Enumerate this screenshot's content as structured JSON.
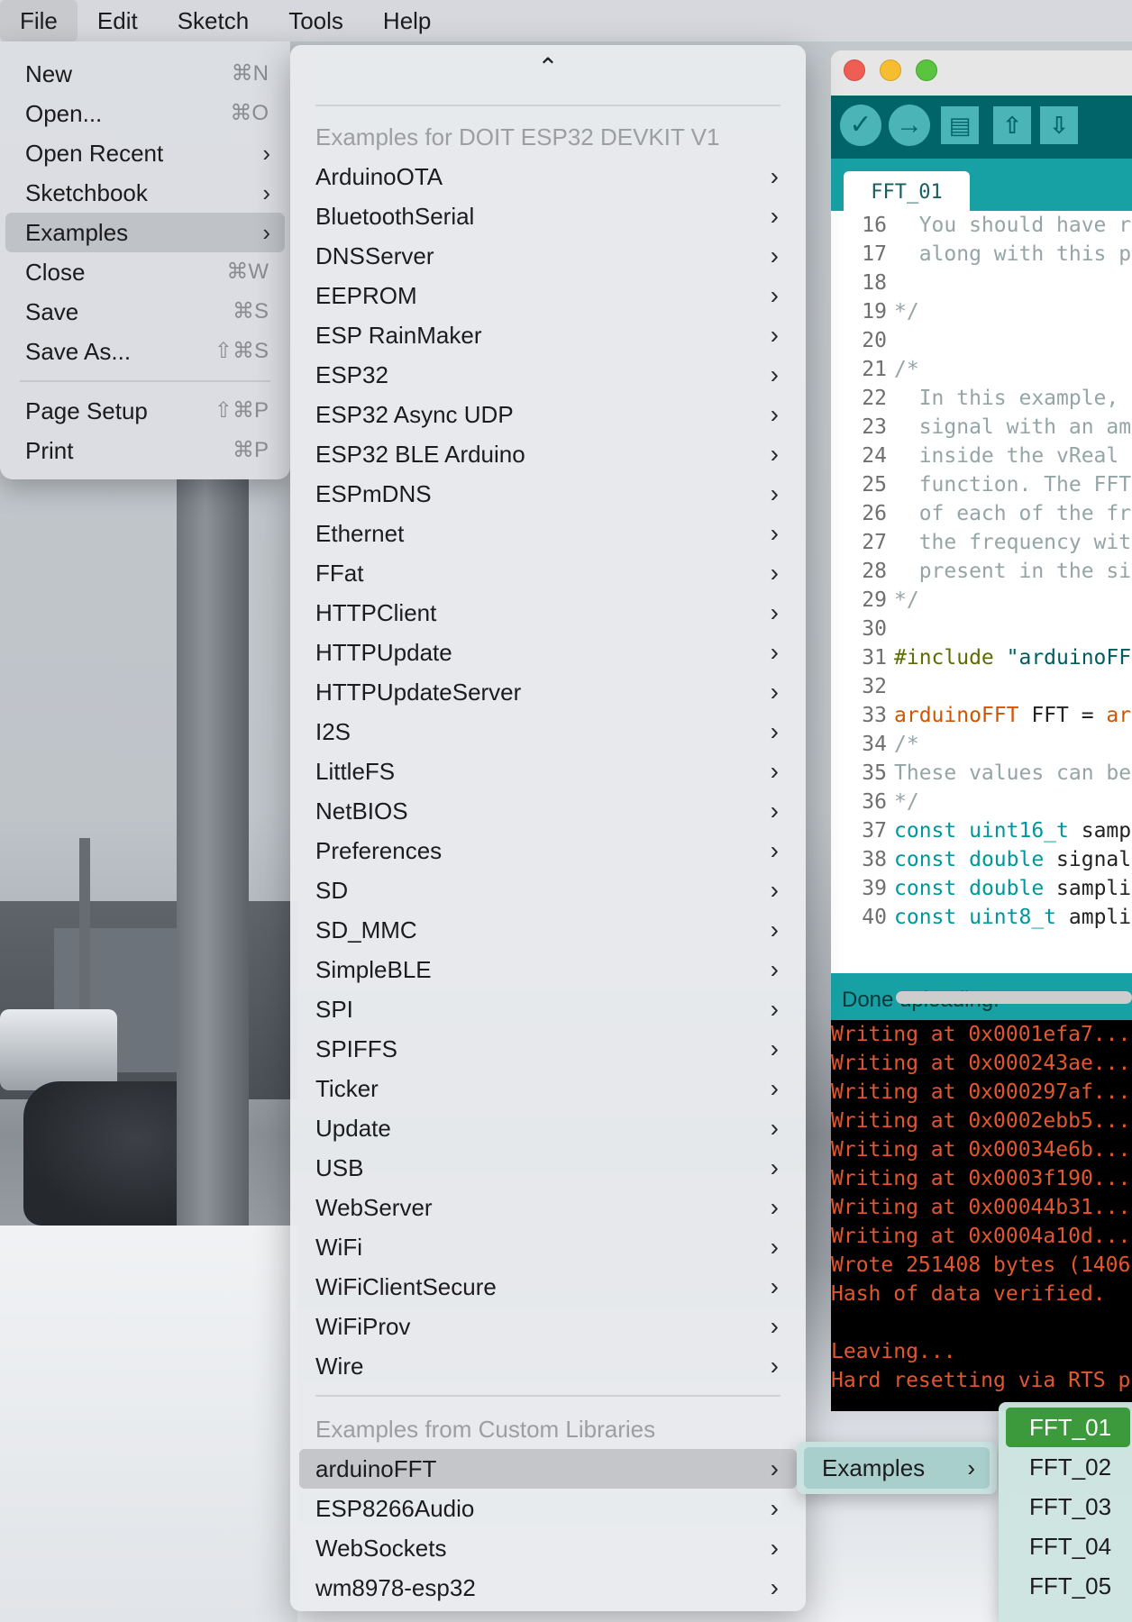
{
  "menubar": {
    "items": [
      "File",
      "Edit",
      "Sketch",
      "Tools",
      "Help"
    ],
    "active": "File"
  },
  "file_menu": {
    "items": [
      {
        "label": "New",
        "shortcut": "⌘N"
      },
      {
        "label": "Open...",
        "shortcut": "⌘O"
      },
      {
        "label": "Open Recent",
        "submenu": true
      },
      {
        "label": "Sketchbook",
        "submenu": true
      },
      {
        "label": "Examples",
        "submenu": true,
        "highlighted": true
      },
      {
        "label": "Close",
        "shortcut": "⌘W"
      },
      {
        "label": "Save",
        "shortcut": "⌘S"
      },
      {
        "label": "Save As...",
        "shortcut": "⇧⌘S"
      },
      {
        "label": "Page Setup",
        "shortcut": "⇧⌘P"
      },
      {
        "label": "Print",
        "shortcut": "⌘P"
      }
    ]
  },
  "examples_menu": {
    "scroll_up_icon": "caret-up-icon",
    "board_header": "Examples for DOIT ESP32 DEVKIT V1",
    "board_items": [
      "ArduinoOTA",
      "BluetoothSerial",
      "DNSServer",
      "EEPROM",
      "ESP RainMaker",
      "ESP32",
      "ESP32 Async UDP",
      "ESP32 BLE Arduino",
      "ESPmDNS",
      "Ethernet",
      "FFat",
      "HTTPClient",
      "HTTPUpdate",
      "HTTPUpdateServer",
      "I2S",
      "LittleFS",
      "NetBIOS",
      "Preferences",
      "SD",
      "SD_MMC",
      "SimpleBLE",
      "SPI",
      "SPIFFS",
      "Ticker",
      "Update",
      "USB",
      "WebServer",
      "WiFi",
      "WiFiClientSecure",
      "WiFiProv",
      "Wire"
    ],
    "custom_header": "Examples from Custom Libraries",
    "custom_items": [
      "arduinoFFT",
      "ESP8266Audio",
      "WebSockets",
      "wm8978-esp32"
    ],
    "highlighted": "arduinoFFT"
  },
  "ide": {
    "tab_label": "FFT_01",
    "colors": {
      "toolbar": "#006468",
      "tabstrip": "#17a1a5",
      "accent": "#4ab4b6"
    },
    "toolbar_icons": [
      "verify-icon",
      "upload-icon",
      "new-icon",
      "open-icon",
      "save-icon"
    ],
    "code_lines": [
      {
        "n": "16",
        "t": "  You should have r"
      },
      {
        "n": "17",
        "t": "  along with this p"
      },
      {
        "n": "18",
        "t": ""
      },
      {
        "n": "19",
        "t": "*/"
      },
      {
        "n": "20",
        "t": ""
      },
      {
        "n": "21",
        "t": "/*"
      },
      {
        "n": "22",
        "t": "  In this example,"
      },
      {
        "n": "23",
        "t": "  signal with an am"
      },
      {
        "n": "24",
        "t": "  inside the vReal"
      },
      {
        "n": "25",
        "t": "  function. The FFT"
      },
      {
        "n": "26",
        "t": "  of each of the fr"
      },
      {
        "n": "27",
        "t": "  the frequency wit"
      },
      {
        "n": "28",
        "t": "  present in the si"
      },
      {
        "n": "29",
        "t": "*/"
      },
      {
        "n": "30",
        "t": ""
      },
      {
        "n": "31",
        "t": "#include \"arduinoFF"
      },
      {
        "n": "32",
        "t": ""
      },
      {
        "n": "33",
        "t": "arduinoFFT FFT = ar"
      },
      {
        "n": "34",
        "t": "/*"
      },
      {
        "n": "35",
        "t": "These values can be"
      },
      {
        "n": "36",
        "t": "*/"
      },
      {
        "n": "37",
        "t": "const uint16_t samp"
      },
      {
        "n": "38",
        "t": "const double signal"
      },
      {
        "n": "39",
        "t": "const double sampli"
      },
      {
        "n": "40",
        "t": "const uint8_t ampli"
      }
    ],
    "status": "Done uploading.",
    "console_lines": [
      "Writing at 0x0001efa7...",
      "Writing at 0x000243ae...",
      "Writing at 0x000297af...",
      "Writing at 0x0002ebb5...",
      "Writing at 0x00034e6b...",
      "Writing at 0x0003f190...",
      "Writing at 0x00044b31...",
      "Writing at 0x0004a10d...",
      "Wrote 251408 bytes (1406",
      "Hash of data verified.",
      "",
      "Leaving...",
      "Hard resetting via RTS p"
    ]
  },
  "library_submenu": {
    "label": "Examples"
  },
  "fft_submenu": {
    "items": [
      "FFT_01",
      "FFT_02",
      "FFT_03",
      "FFT_04",
      "FFT_05"
    ],
    "selected": "FFT_01"
  }
}
